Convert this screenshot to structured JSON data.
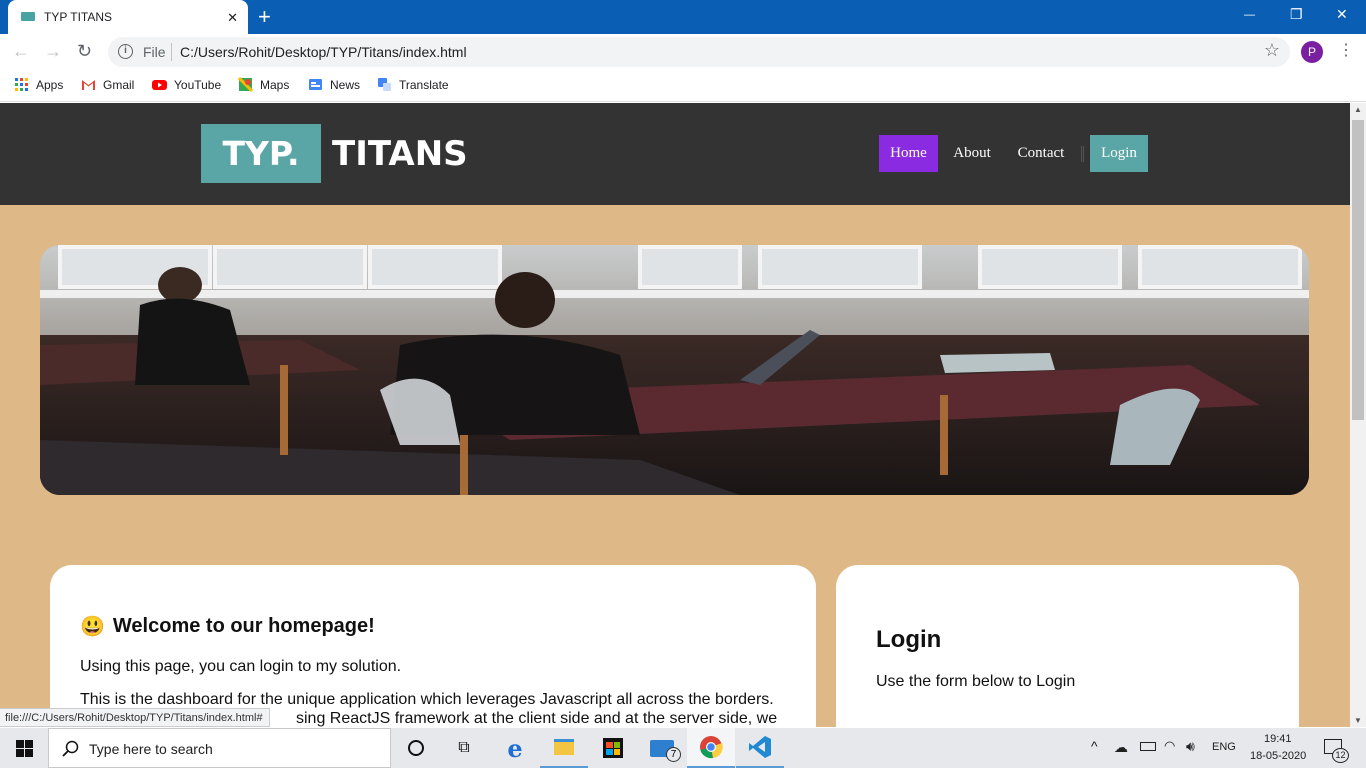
{
  "browser": {
    "tab_title": "TYP TITANS",
    "tab_close": "✕",
    "new_tab": "+",
    "window_controls": {
      "minimize": "—",
      "restore": "❐",
      "close": "✕"
    },
    "omnibox": {
      "scheme_label": "File",
      "url": "C:/Users/Rohit/Desktop/TYP/Titans/index.html"
    },
    "profile_initial": "P",
    "bookmarks": [
      {
        "label": "Apps",
        "icon": "apps-grid-icon"
      },
      {
        "label": "Gmail",
        "icon": "gmail-icon"
      },
      {
        "label": "YouTube",
        "icon": "youtube-icon"
      },
      {
        "label": "Maps",
        "icon": "maps-icon"
      },
      {
        "label": "News",
        "icon": "news-icon"
      },
      {
        "label": "Translate",
        "icon": "translate-icon"
      }
    ],
    "status_url": "file:///C:/Users/Rohit/Desktop/TYP/Titans/index.html#"
  },
  "site": {
    "logo_box": "TYP.",
    "logo_text": "TITANS",
    "nav": [
      {
        "label": "Home",
        "active": true
      },
      {
        "label": "About"
      },
      {
        "label": "Contact"
      },
      {
        "label": "Login"
      }
    ],
    "welcome": {
      "emoji": "😃",
      "heading": "Welcome to our homepage!",
      "para1": "Using this page, you can login to my solution.",
      "para2_line1": "This is the dashboard for the unique application which leverages Javascript all across the borders.",
      "para2_line2": "sing ReactJS framework at the client side and at the server side, we"
    },
    "login": {
      "heading": "Login",
      "text": "Use the form below to Login"
    },
    "colors": {
      "page_bg": "#deb887",
      "header_bg": "#333333",
      "active_nav": "#8a2be2",
      "teal": "#5aa5a5"
    }
  },
  "taskbar": {
    "search_placeholder": "Type here to search",
    "mail_badge": "7",
    "language": "ENG",
    "time": "19:41",
    "date": "18-05-2020",
    "notification_count": "12"
  }
}
